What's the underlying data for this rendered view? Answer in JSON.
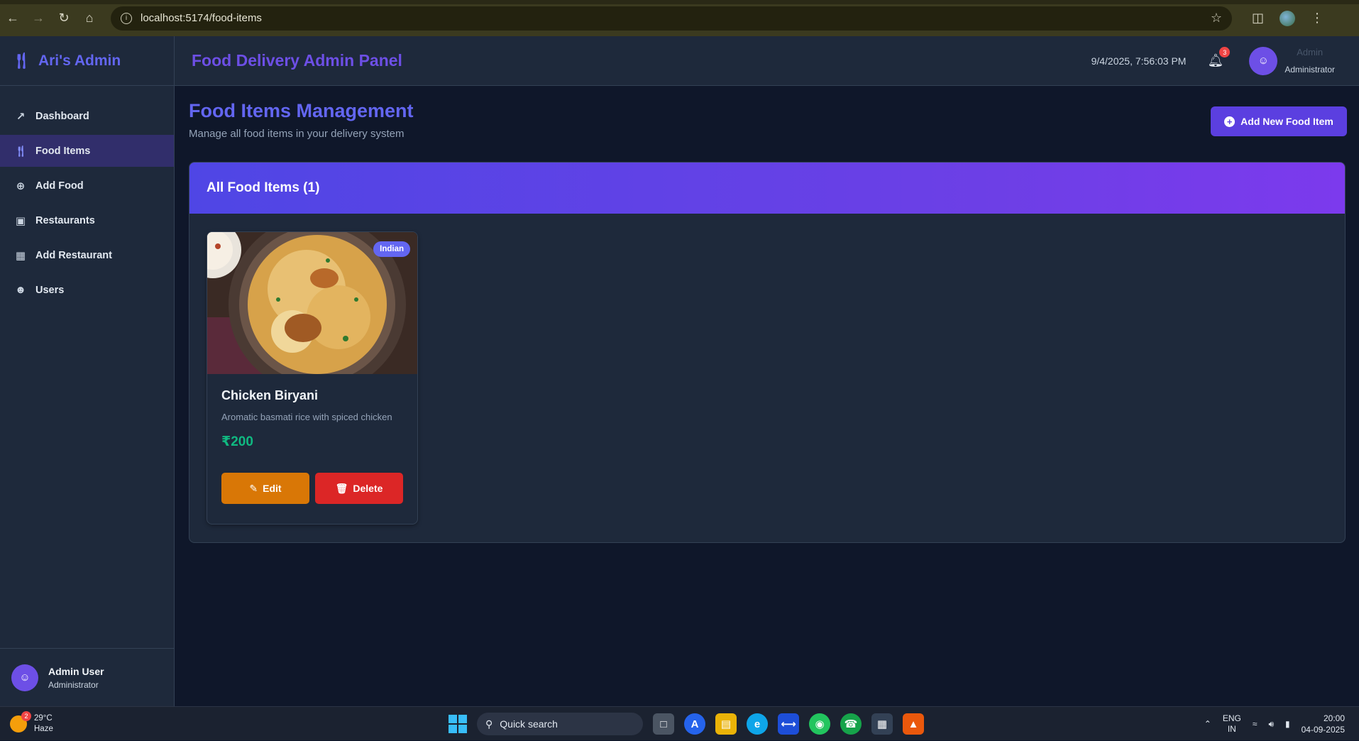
{
  "browser": {
    "url": "localhost:5174/food-items"
  },
  "sidebar": {
    "brand": "Ari's Admin",
    "items": [
      {
        "label": "Dashboard",
        "icon": "chart-line-icon",
        "active": false
      },
      {
        "label": "Food Items",
        "icon": "utensils-icon",
        "active": true
      },
      {
        "label": "Add Food",
        "icon": "plus-circle-icon",
        "active": false
      },
      {
        "label": "Restaurants",
        "icon": "store-icon",
        "active": false
      },
      {
        "label": "Add Restaurant",
        "icon": "building-icon",
        "active": false
      },
      {
        "label": "Users",
        "icon": "users-icon",
        "active": false
      }
    ],
    "footer": {
      "name": "Admin User",
      "role": "Administrator"
    }
  },
  "header": {
    "title": "Food Delivery Admin Panel",
    "datetime": "9/4/2025, 7:56:03 PM",
    "notification_count": "3",
    "user_name": "Admin",
    "user_role": "Administrator"
  },
  "page": {
    "title": "Food Items Management",
    "subtitle": "Manage all food items in your delivery system",
    "add_button": "Add New Food Item",
    "panel_title": "All Food Items (1)"
  },
  "foods": [
    {
      "name": "Chicken Biryani",
      "description": "Aromatic basmati rice with spiced chicken",
      "price": "₹200",
      "cuisine": "Indian",
      "edit_label": "Edit",
      "delete_label": "Delete"
    }
  ],
  "taskbar": {
    "temperature": "29°C",
    "weather": "Haze",
    "weather_badge": "2",
    "search_placeholder": "Quick search",
    "lang_top": "ENG",
    "lang_bottom": "IN",
    "time": "20:00",
    "date": "04-09-2025"
  },
  "colors": {
    "accent": "#6366f1",
    "price": "#10b981",
    "edit": "#d97706",
    "delete": "#dc2626"
  }
}
